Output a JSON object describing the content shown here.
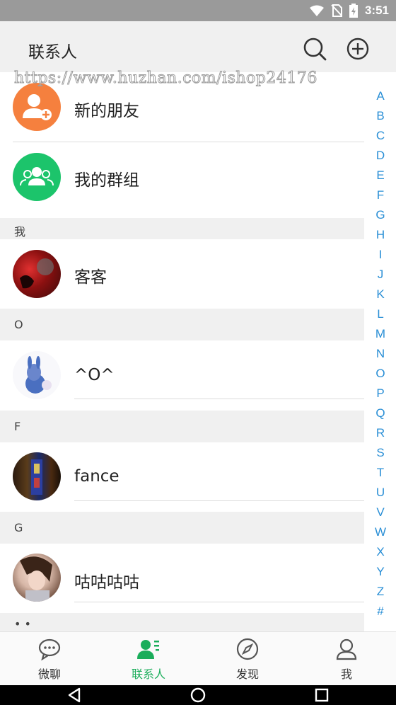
{
  "status_bar": {
    "time": "3:51",
    "icons": [
      "wifi-icon",
      "no-sim-icon",
      "battery-icon"
    ]
  },
  "app_bar": {
    "title": "联系人",
    "actions": [
      "search-icon",
      "add-circle-icon"
    ]
  },
  "watermark": "https://www.huzhan.com/ishop24176",
  "rows": [
    {
      "label": "新的朋友",
      "icon": "new-friend-icon",
      "color": "#f5803e"
    },
    {
      "label": "我的群组",
      "icon": "group-icon",
      "color": "#1cc46b"
    }
  ],
  "sections": [
    {
      "header": "我",
      "contacts": [
        {
          "name": "客客",
          "avatar": "avatar-photo"
        }
      ]
    },
    {
      "header": "O",
      "contacts": [
        {
          "name": "^O^",
          "avatar": "avatar-donkey"
        }
      ]
    },
    {
      "header": "F",
      "contacts": [
        {
          "name": "fance",
          "avatar": "avatar-photo"
        }
      ]
    },
    {
      "header": "G",
      "contacts": [
        {
          "name": "咕咕咕咕",
          "avatar": "avatar-photo"
        }
      ]
    }
  ],
  "partial_section_header": "• •",
  "index_letters": [
    "A",
    "B",
    "C",
    "D",
    "E",
    "F",
    "G",
    "H",
    "I",
    "J",
    "K",
    "L",
    "M",
    "N",
    "O",
    "P",
    "Q",
    "R",
    "S",
    "T",
    "U",
    "V",
    "W",
    "X",
    "Y",
    "Z",
    "#"
  ],
  "tabs": [
    {
      "label": "微聊",
      "icon": "chat-icon",
      "active": false
    },
    {
      "label": "联系人",
      "icon": "contacts-icon",
      "active": true
    },
    {
      "label": "发现",
      "icon": "compass-icon",
      "active": false
    },
    {
      "label": "我",
      "icon": "profile-icon",
      "active": false
    }
  ],
  "colors": {
    "accent": "#1aad5a",
    "index": "#2a8fd6",
    "new_friend": "#f5803e",
    "group": "#1cc46b"
  },
  "nav_buttons": [
    "back-icon",
    "home-icon",
    "recents-icon"
  ]
}
